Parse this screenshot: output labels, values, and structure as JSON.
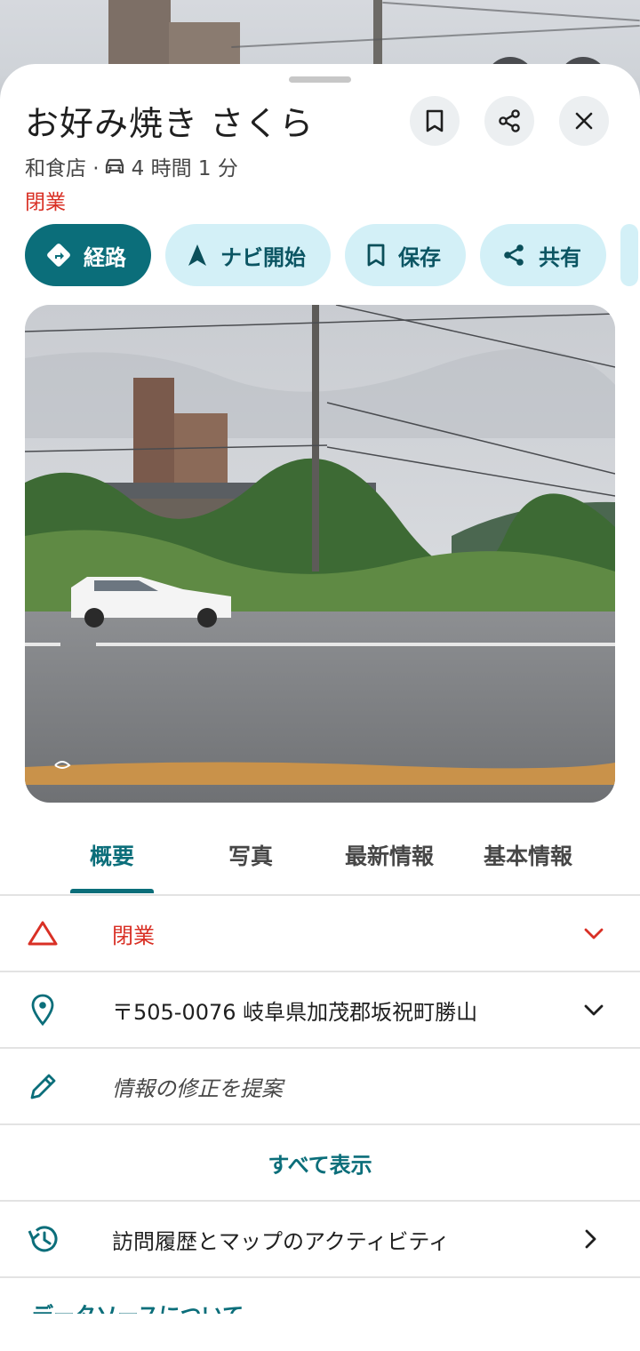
{
  "place": {
    "name": "お好み焼き さくら",
    "category": "和食店 ·",
    "drive_time": "4 時間 1 分",
    "status": "閉業"
  },
  "header_buttons": {
    "save_icon": "bookmark-icon",
    "share_icon": "share-icon",
    "close_icon": "close-icon"
  },
  "actions": [
    {
      "label": "経路",
      "icon": "directions-icon"
    },
    {
      "label": "ナビ開始",
      "icon": "navigation-arrow-icon"
    },
    {
      "label": "保存",
      "icon": "bookmark-icon"
    },
    {
      "label": "共有",
      "icon": "share-icon"
    }
  ],
  "tabs": [
    "概要",
    "写真",
    "最新情報",
    "基本情報"
  ],
  "active_tab": 0,
  "info_rows": {
    "status": "閉業",
    "address": "〒505-0076 岐阜県加茂郡坂祝町勝山",
    "suggest_edit": "情報の修正を提案",
    "show_all": "すべて表示",
    "activity": "訪問履歴とマップのアクティビティ"
  },
  "footer_link": "データソースについて",
  "colors": {
    "accent": "#0b6e7a",
    "chip_bg": "#d3f0f7",
    "closed_red": "#d93025"
  }
}
